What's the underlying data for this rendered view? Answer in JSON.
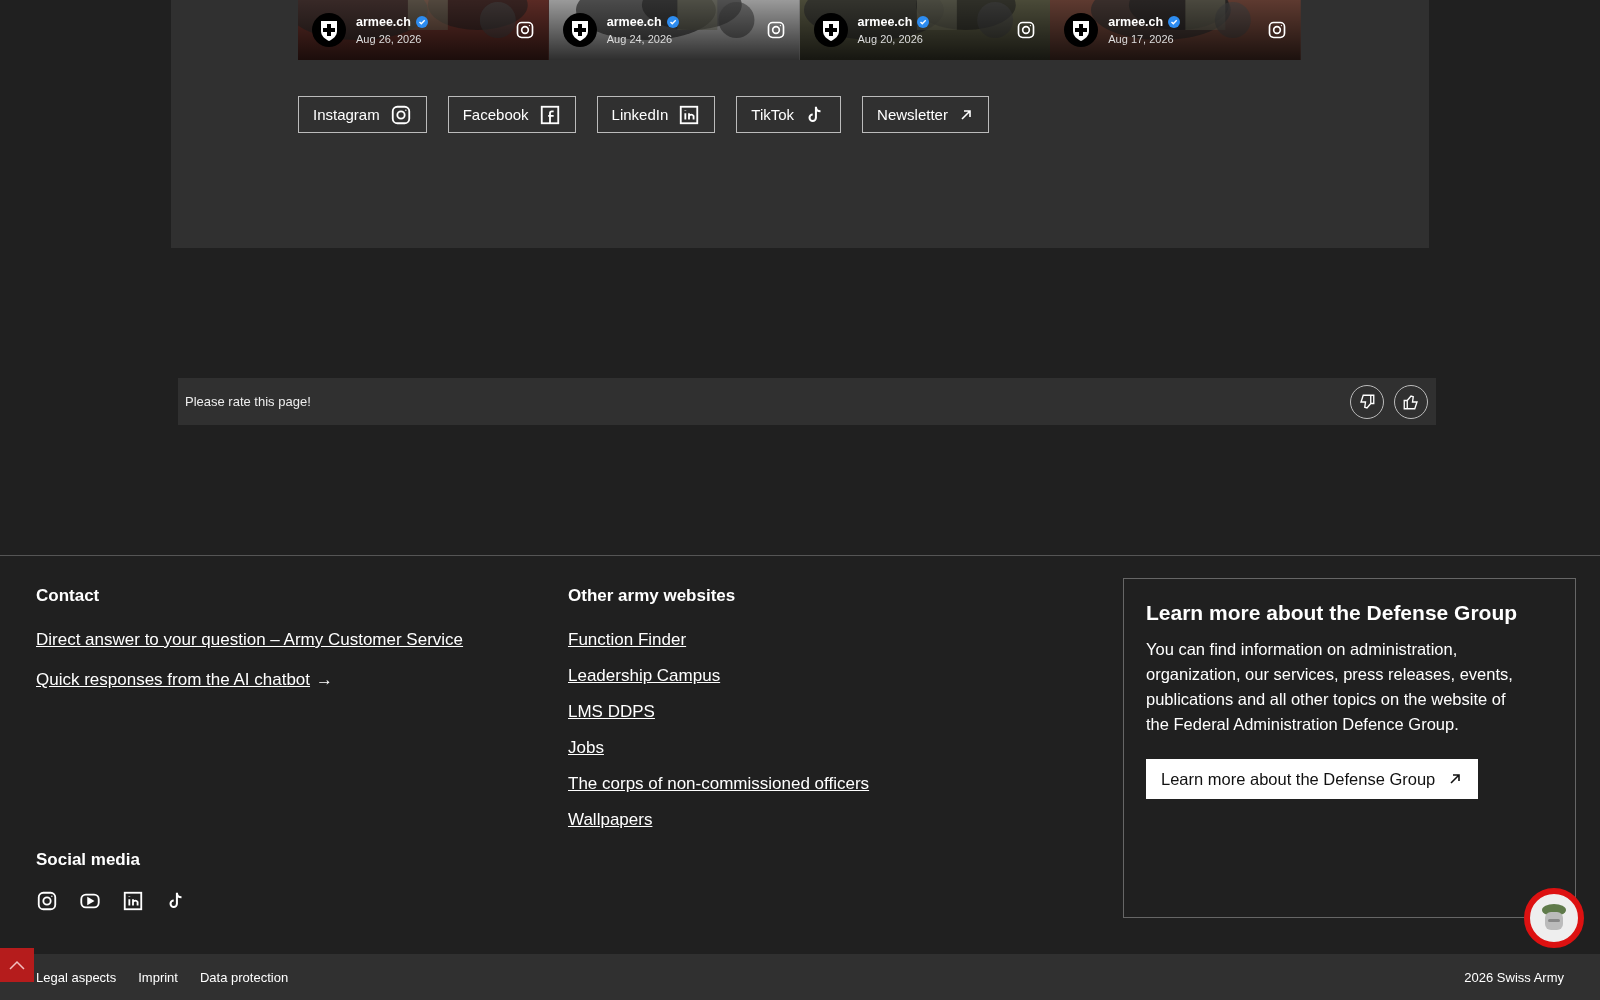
{
  "posts": [
    {
      "account": "armee.ch",
      "date": "Aug 26, 2026"
    },
    {
      "account": "armee.ch",
      "date": "Aug 24, 2026"
    },
    {
      "account": "armee.ch",
      "date": "Aug 20, 2026"
    },
    {
      "account": "armee.ch",
      "date": "Aug 17, 2026"
    }
  ],
  "social_buttons": [
    {
      "label": "Instagram",
      "kind": "instagram"
    },
    {
      "label": "Facebook",
      "kind": "facebook"
    },
    {
      "label": "LinkedIn",
      "kind": "linkedin"
    },
    {
      "label": "TikTok",
      "kind": "tiktok"
    },
    {
      "label": "Newsletter",
      "kind": "external"
    }
  ],
  "rating": {
    "prompt": "Please rate this page!"
  },
  "footer": {
    "contact": {
      "heading": "Contact",
      "links": [
        {
          "label": "Direct answer to your question – Army Customer Service"
        },
        {
          "label": "Quick responses from the AI chatbot",
          "suffix": "→"
        }
      ]
    },
    "other": {
      "heading": "Other army websites",
      "links": [
        {
          "label": "Function Finder"
        },
        {
          "label": "Leadership Campus"
        },
        {
          "label": "LMS DDPS"
        },
        {
          "label": "Jobs"
        },
        {
          "label": "The corps of non-commissioned officers"
        },
        {
          "label": "Wallpapers"
        }
      ]
    },
    "social": {
      "heading": "Social media",
      "icons": [
        {
          "kind": "instagram"
        },
        {
          "kind": "youtube"
        },
        {
          "kind": "linkedin"
        },
        {
          "kind": "tiktok"
        }
      ]
    },
    "promo": {
      "title": "Learn more about the Defense Group",
      "text": "You can find information on administration, organization, our services, press releases, events, publications and all other topics on the website of the Federal Administration Defence Group.",
      "button": "Learn more about the Defense Group"
    },
    "bottom": {
      "links": [
        "Legal aspects",
        "Imprint",
        "Data protection"
      ],
      "copyright": "2026 Swiss Army"
    }
  }
}
